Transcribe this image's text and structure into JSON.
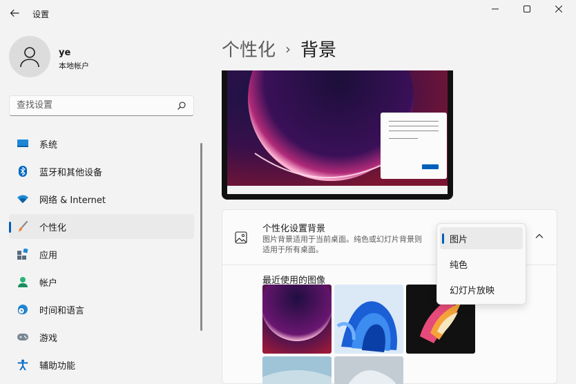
{
  "window": {
    "title": "设置",
    "controls": {
      "minimize": "minimize-icon",
      "maximize": "maximize-icon",
      "close": "close-icon"
    }
  },
  "profile": {
    "name": "ye",
    "account_type": "本地帐户",
    "avatar_icon": "person-icon"
  },
  "search": {
    "placeholder": "查找设置",
    "value": "",
    "icon": "search-icon"
  },
  "nav": {
    "items": [
      {
        "label": "系统",
        "icon": "system-icon",
        "active": false
      },
      {
        "label": "蓝牙和其他设备",
        "icon": "bluetooth-icon",
        "active": false
      },
      {
        "label": "网络 & Internet",
        "icon": "wifi-icon",
        "active": false
      },
      {
        "label": "个性化",
        "icon": "brush-icon",
        "active": true
      },
      {
        "label": "应用",
        "icon": "apps-icon",
        "active": false
      },
      {
        "label": "帐户",
        "icon": "account-icon",
        "active": false
      },
      {
        "label": "时间和语言",
        "icon": "time-language-icon",
        "active": false
      },
      {
        "label": "游戏",
        "icon": "gamepad-icon",
        "active": false
      },
      {
        "label": "辅助功能",
        "icon": "accessibility-icon",
        "active": false
      }
    ]
  },
  "breadcrumb": {
    "parent": "个性化",
    "separator": "›",
    "current": "背景"
  },
  "background_card": {
    "title": "个性化设置背景",
    "description": "图片背景适用于当前桌面。纯色或幻灯片背景则适用于所有桌面。",
    "icon": "image-icon",
    "chevron": "chevron-up-icon",
    "recent_label": "最近使用的图像"
  },
  "dropdown": {
    "options": [
      "图片",
      "纯色",
      "幻灯片放映"
    ],
    "selected": "图片"
  },
  "colors": {
    "accent": "#005fb8",
    "background": "#f3f3f3",
    "card": "#fbfbfb"
  }
}
